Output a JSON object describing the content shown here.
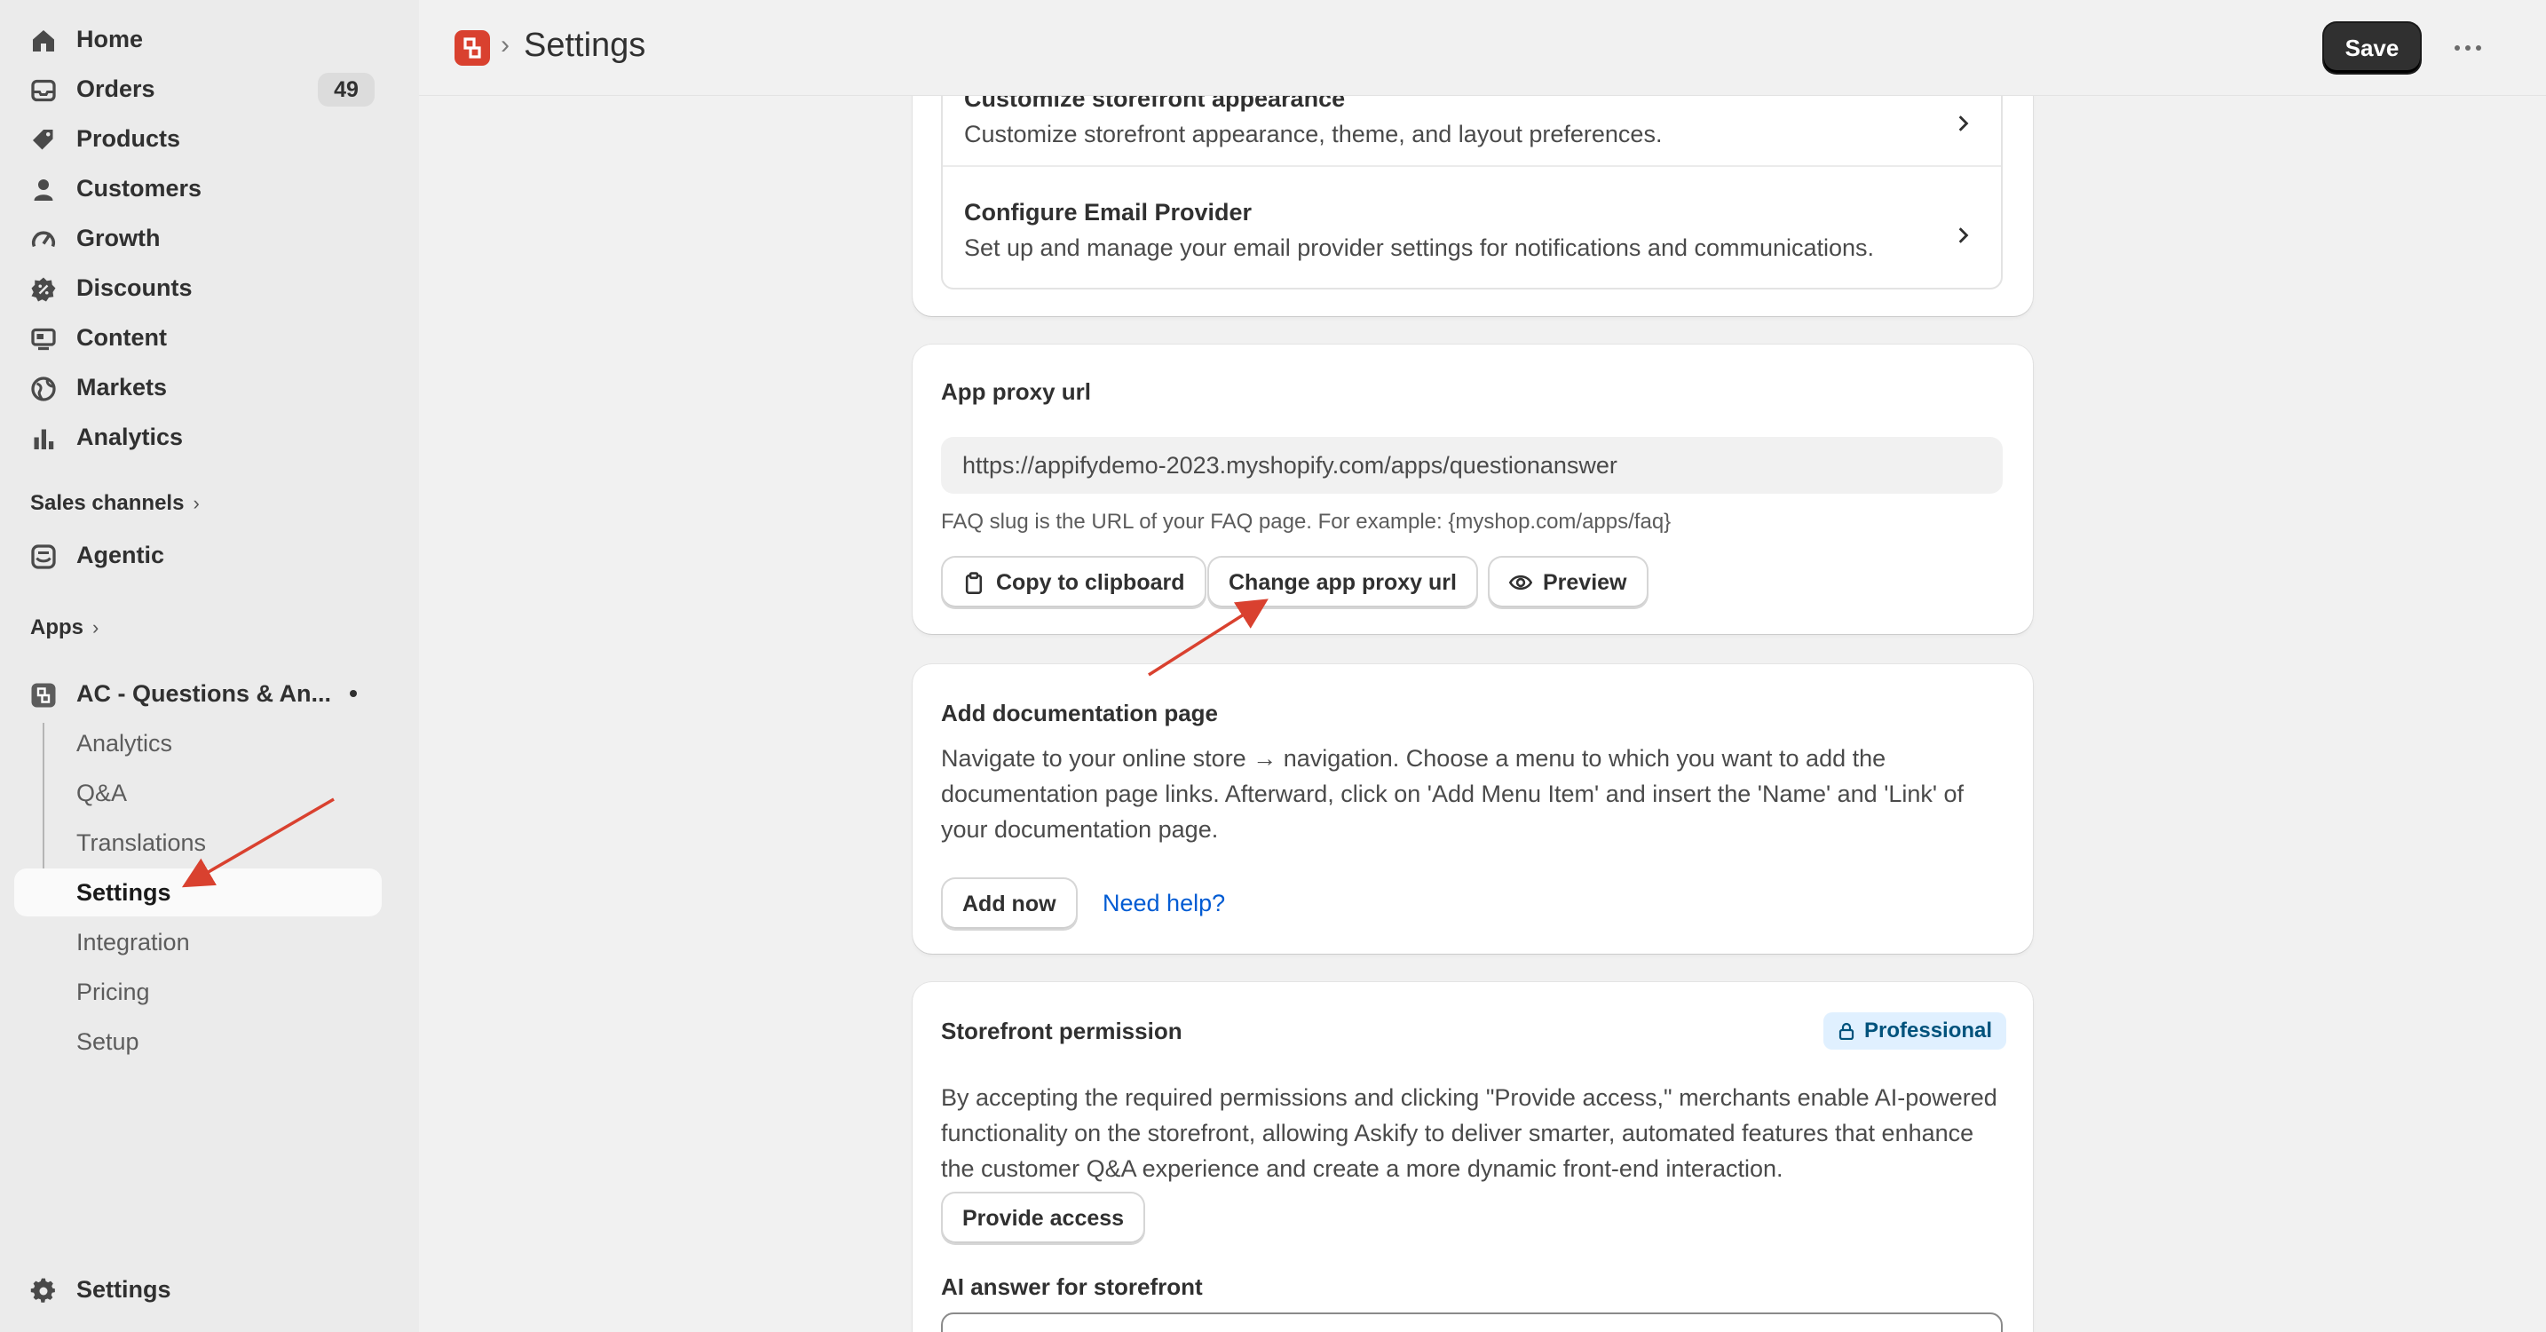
{
  "sidebar": {
    "nav": [
      {
        "label": "Home",
        "icon": "home-icon"
      },
      {
        "label": "Orders",
        "icon": "orders-icon",
        "badge": "49"
      },
      {
        "label": "Products",
        "icon": "tag-icon"
      },
      {
        "label": "Customers",
        "icon": "person-icon"
      },
      {
        "label": "Growth",
        "icon": "gauge-icon"
      },
      {
        "label": "Discounts",
        "icon": "discount-icon"
      },
      {
        "label": "Content",
        "icon": "content-icon"
      },
      {
        "label": "Markets",
        "icon": "globe-icon"
      },
      {
        "label": "Analytics",
        "icon": "bar-chart-icon"
      }
    ],
    "sales_channels": {
      "label": "Sales channels"
    },
    "agentic": {
      "label": "Agentic"
    },
    "apps": {
      "label": "Apps"
    },
    "app_name": "AC - Questions & An...",
    "app_subnav": [
      "Analytics",
      "Q&A",
      "Translations",
      "Settings",
      "Integration",
      "Pricing",
      "Setup"
    ],
    "active_subnav": "Settings",
    "settings": {
      "label": "Settings"
    }
  },
  "topbar": {
    "title": "Settings",
    "separator": "›",
    "save_label": "Save"
  },
  "storefront_list": {
    "rows": [
      {
        "title": "Customize storefront appearance",
        "desc": "Customize storefront appearance, theme, and layout preferences."
      },
      {
        "title": "Configure Email Provider",
        "desc": "Set up and manage your email provider settings for notifications and communications."
      }
    ]
  },
  "app_proxy": {
    "title": "App proxy url",
    "url": "https://appifydemo-2023.myshopify.com/apps/questionanswer",
    "help": "FAQ slug is the URL of your FAQ page. For example: {myshop.com/apps/faq}",
    "copy_label": "Copy to clipboard",
    "change_label": "Change app proxy url",
    "preview_label": "Preview"
  },
  "documentation": {
    "title": "Add documentation page",
    "text": "Navigate to your online store → navigation. Choose a menu to which you want to add the documentation page links. Afterward, click on 'Add Menu Item' and insert the 'Name' and 'Link' of your documentation page.",
    "add_label": "Add now",
    "help_link": "Need help?"
  },
  "storefront_permission": {
    "title": "Storefront permission",
    "badge": "Professional",
    "text": "By accepting the required permissions and clicking \"Provide access,\" merchants enable AI-powered functionality on the storefront, allowing Askify to deliver smarter, automated features that enhance the customer Q&A experience and create a more dynamic front-end interaction.",
    "provide_label": "Provide access",
    "ai_label": "AI answer for storefront"
  },
  "colors": {
    "annotation_arrow": "#d9412f",
    "link": "#005bd3",
    "badge_bg": "#e0f0ff"
  }
}
